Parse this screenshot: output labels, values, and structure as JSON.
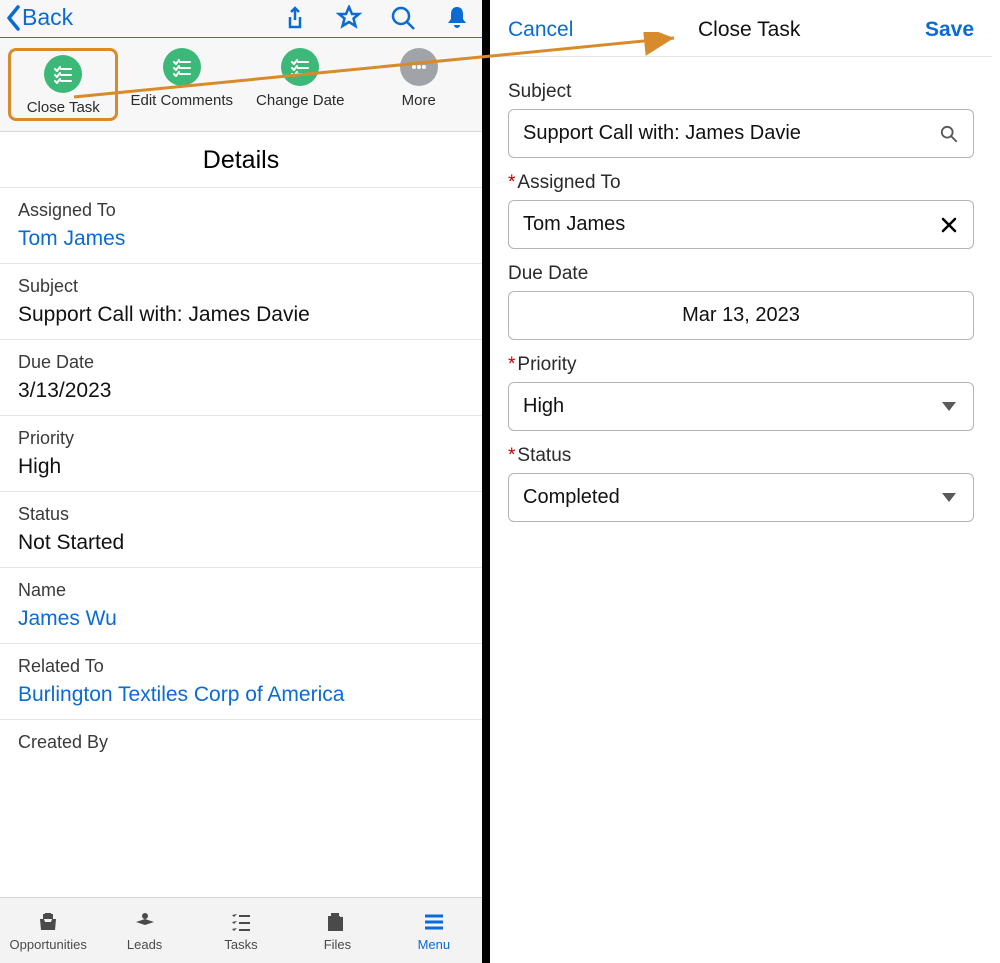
{
  "left": {
    "back_label": "Back",
    "actions": [
      {
        "label": "Close Task"
      },
      {
        "label": "Edit Comments"
      },
      {
        "label": "Change Date"
      },
      {
        "label": "More"
      }
    ],
    "details_title": "Details",
    "rows": {
      "assigned_to_label": "Assigned To",
      "assigned_to_value": "Tom James",
      "subject_label": "Subject",
      "subject_value": "Support Call with: James Davie",
      "due_date_label": "Due Date",
      "due_date_value": "3/13/2023",
      "priority_label": "Priority",
      "priority_value": "High",
      "status_label": "Status",
      "status_value": "Not Started",
      "name_label": "Name",
      "name_value": "James Wu",
      "related_to_label": "Related To",
      "related_to_value": "Burlington Textiles Corp of America",
      "created_by_label": "Created By"
    },
    "tabs": [
      {
        "label": "Opportunities"
      },
      {
        "label": "Leads"
      },
      {
        "label": "Tasks"
      },
      {
        "label": "Files"
      },
      {
        "label": "Menu"
      }
    ]
  },
  "right": {
    "cancel_label": "Cancel",
    "title": "Close Task",
    "save_label": "Save",
    "subject_label": "Subject",
    "subject_value": "Support Call with: James Davie",
    "assigned_to_label": "Assigned To",
    "assigned_to_value": "Tom James",
    "due_date_label": "Due Date",
    "due_date_value": "Mar 13, 2023",
    "priority_label": "Priority",
    "priority_value": "High",
    "status_label": "Status",
    "status_value": "Completed"
  }
}
